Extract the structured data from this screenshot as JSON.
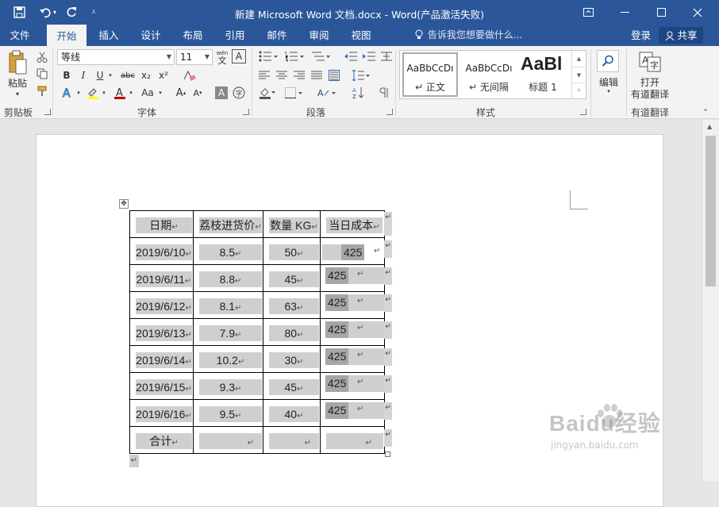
{
  "window": {
    "title": "新建 Microsoft Word 文档.docx - Word(产品激活失败)"
  },
  "tabs": [
    "文件",
    "开始",
    "插入",
    "设计",
    "布局",
    "引用",
    "邮件",
    "审阅",
    "视图"
  ],
  "tell_me": "告诉我您想要做什么...",
  "account": {
    "login": "登录",
    "share": "共享"
  },
  "ribbon": {
    "clipboard": {
      "paste": "粘贴",
      "label": "剪贴板"
    },
    "font": {
      "name": "等线",
      "size": "11",
      "label": "字体",
      "bold": "B",
      "italic": "I",
      "underline": "U",
      "strike": "abc",
      "sub": "x₂",
      "sup": "x²",
      "case": "Aa",
      "grow": "A",
      "shrink": "A"
    },
    "paragraph": {
      "label": "段落"
    },
    "styles": {
      "label": "样式",
      "items": [
        {
          "preview": "AaBbCcDı",
          "name": "↵ 正文"
        },
        {
          "preview": "AaBbCcDı",
          "name": "↵ 无间隔"
        },
        {
          "preview": "AaBl",
          "name": "标题 1"
        }
      ]
    },
    "editing": {
      "label": "编辑"
    },
    "youdao": {
      "line1": "打开",
      "line2": "有道翻译",
      "label": "有道翻译"
    }
  },
  "table": {
    "headers": [
      "日期",
      "荔枝进货价",
      "数量 KG",
      "当日成本"
    ],
    "rows": [
      {
        "date": "2019/6/10",
        "price": "8.5",
        "qty": "50",
        "cost": "425"
      },
      {
        "date": "2019/6/11",
        "price": "8.8",
        "qty": "45",
        "cost": "425"
      },
      {
        "date": "2019/6/12",
        "price": "8.1",
        "qty": "63",
        "cost": "425"
      },
      {
        "date": "2019/6/13",
        "price": "7.9",
        "qty": "80",
        "cost": "425"
      },
      {
        "date": "2019/6/14",
        "price": "10.2",
        "qty": "30",
        "cost": "425"
      },
      {
        "date": "2019/6/15",
        "price": "9.3",
        "qty": "45",
        "cost": "425"
      },
      {
        "date": "2019/6/16",
        "price": "9.5",
        "qty": "40",
        "cost": "425"
      }
    ],
    "total_label": "合计"
  },
  "watermark": {
    "brand": "Baidu经验",
    "url": "jingyan.baidu.com"
  }
}
